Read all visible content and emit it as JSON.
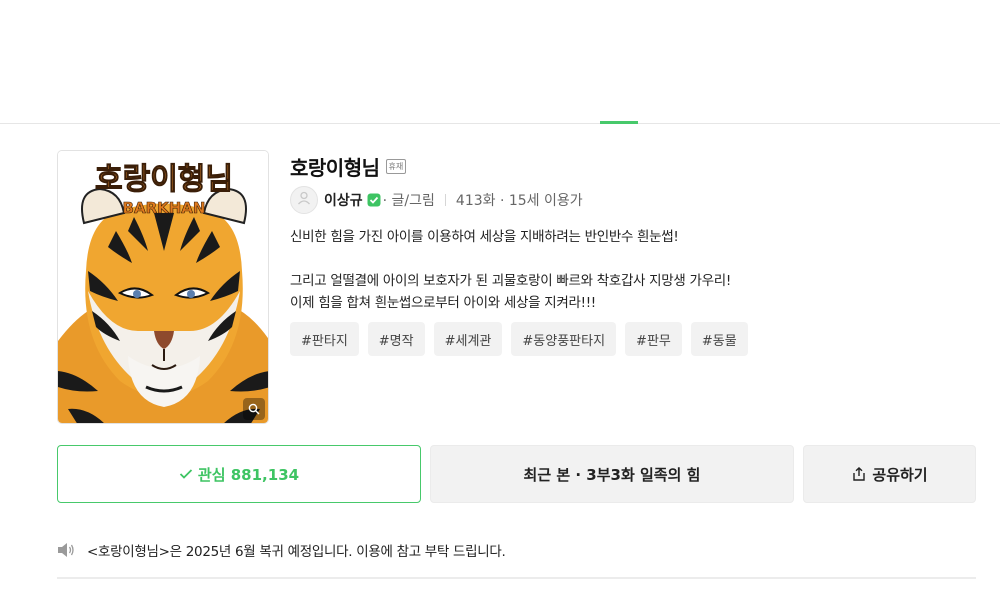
{
  "work": {
    "title": "호랑이형님",
    "status_tag": "휴재",
    "author": "이상규",
    "role": "· 글/그림",
    "meta": "413화 · 15세 이용가",
    "cover": {
      "logo_text": "호랑이형님",
      "logo_subtitle": "BARKHAN"
    },
    "description": [
      "신비한 힘을 가진 아이를 이용하여 세상을 지배하려는 반인반수 흰눈썹!",
      "그리고 얼떨결에 아이의 보호자가 된 괴물호랑이 빠르와 착호갑사 지망생 가우리!",
      "이제 힘을 합쳐 흰눈썹으로부터 아이와 세상을 지켜라!!!"
    ],
    "tags": [
      "#판타지",
      "#명작",
      "#세계관",
      "#동양풍판타지",
      "#판무",
      "#동물"
    ]
  },
  "actions": {
    "favorite_label": "관심 881,134",
    "recent_label": "최근 본 · 3부3화 일족의 힘",
    "share_label": "공유하기"
  },
  "notice": {
    "text": "<호랑이형님>은 2025년 6월 복귀 예정입니다. 이용에 참고 부탁 드립니다."
  },
  "icons": {
    "zoom": "magnifier-icon",
    "avatar": "user-icon",
    "verified": "check-badge-icon",
    "favorite": "check-icon",
    "share": "share-icon",
    "notice": "speaker-icon"
  },
  "colors": {
    "accent": "#3ec463",
    "tag_bg": "#f2f2f2"
  }
}
